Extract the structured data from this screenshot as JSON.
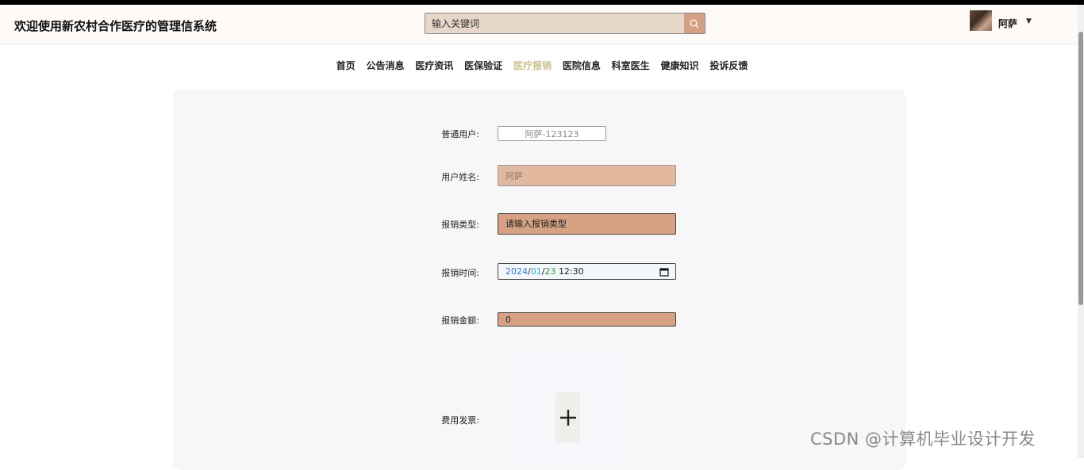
{
  "header": {
    "title": "欢迎使用新农村合作医疗的管理信系统",
    "search_placeholder": "输入关键词",
    "username": "阿萨"
  },
  "nav": {
    "items": [
      {
        "label": "首页",
        "active": false
      },
      {
        "label": "公告消息",
        "active": false
      },
      {
        "label": "医疗资讯",
        "active": false
      },
      {
        "label": "医保验证",
        "active": false
      },
      {
        "label": "医疗报销",
        "active": true
      },
      {
        "label": "医院信息",
        "active": false
      },
      {
        "label": "科室医生",
        "active": false
      },
      {
        "label": "健康知识",
        "active": false
      },
      {
        "label": "投诉反馈",
        "active": false
      }
    ]
  },
  "form": {
    "regular_user_label": "普通用户:",
    "regular_user_value": "阿萨-123123",
    "user_name_label": "用户姓名:",
    "user_name_value": "阿萨",
    "reimburse_type_label": "报销类型:",
    "reimburse_type_placeholder": "请输入报销类型",
    "reimburse_time_label": "报销时间:",
    "date_year": "2024",
    "date_month": "01",
    "date_day": "23",
    "date_time": "12:30",
    "amount_label": "报销金额:",
    "amount_value": "0",
    "invoice_label": "费用发票:",
    "upload_plus": "+"
  },
  "watermark": "CSDN @计算机毕业设计开发"
}
